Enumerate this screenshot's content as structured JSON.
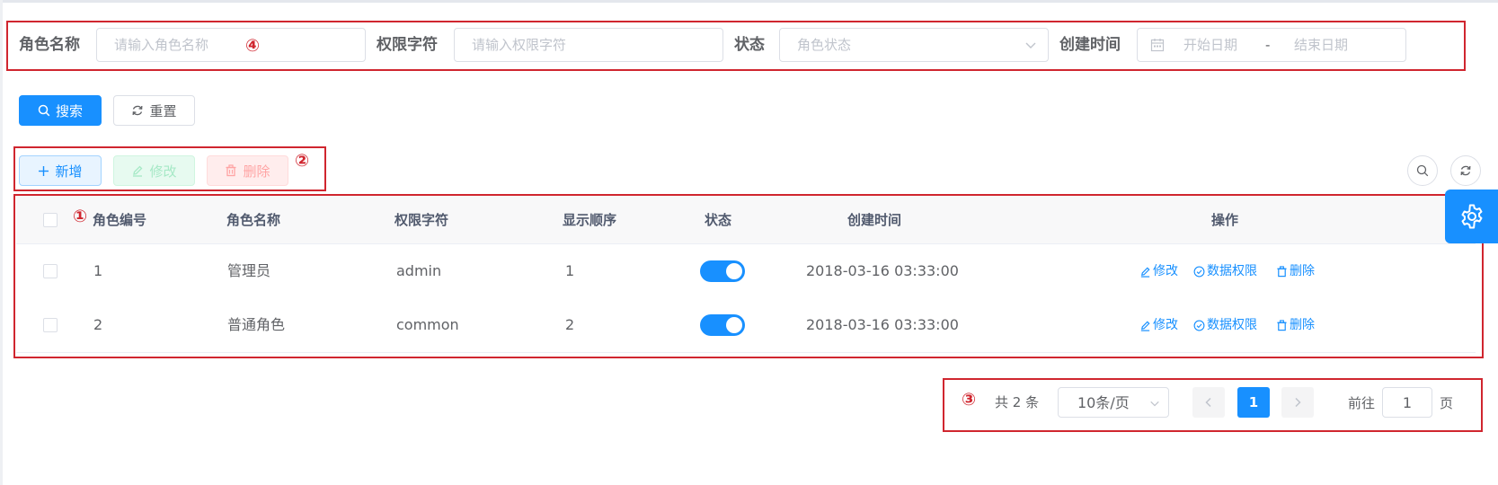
{
  "form": {
    "role_name_label": "角色名称",
    "role_name_placeholder": "请输入角色名称",
    "role_key_label": "权限字符",
    "role_key_placeholder": "请输入权限字符",
    "status_label": "状态",
    "status_placeholder": "角色状态",
    "created_label": "创建时间",
    "start_placeholder": "开始日期",
    "range_separator": "-",
    "end_placeholder": "结束日期"
  },
  "actions": {
    "search": "搜索",
    "reset": "重置",
    "add": "新增",
    "edit": "修改",
    "delete": "删除"
  },
  "markers": {
    "m1": "①",
    "m2": "②",
    "m3": "③",
    "m4": "④"
  },
  "table": {
    "headers": {
      "role_id": "角色编号",
      "role_name": "角色名称",
      "role_key": "权限字符",
      "sort": "显示顺序",
      "status": "状态",
      "created": "创建时间",
      "operation": "操作"
    },
    "rows": [
      {
        "id": "1",
        "name": "管理员",
        "key": "admin",
        "sort": "1",
        "status_on": true,
        "created": "2018-03-16 03:33:00",
        "op_edit": "修改",
        "op_data": "数据权限",
        "op_delete": "删除"
      },
      {
        "id": "2",
        "name": "普通角色",
        "key": "common",
        "sort": "2",
        "status_on": true,
        "created": "2018-03-16 03:33:00",
        "op_edit": "修改",
        "op_data": "数据权限",
        "op_delete": "删除"
      }
    ]
  },
  "pagination": {
    "total": "共 2 条",
    "page_size": "10条/页",
    "current_page": "1",
    "goto_label": "前往",
    "goto_value": "1",
    "page_suffix": "页"
  },
  "colors": {
    "primary": "#1890ff",
    "annotation": "#d0262f",
    "success_plain": "#e7faf0",
    "danger_plain": "#ffeded"
  }
}
